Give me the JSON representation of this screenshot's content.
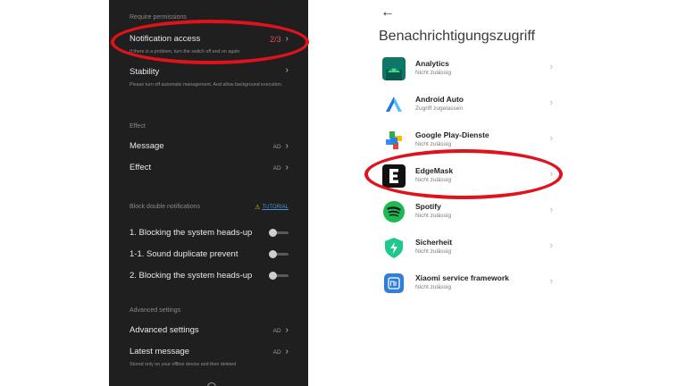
{
  "left_panel": {
    "section_require": "Require permissions",
    "notification_access": {
      "label": "Notification access",
      "value": "2/3",
      "hint": "If there is a problem, turn the switch off and on again"
    },
    "stability": {
      "label": "Stability",
      "hint": "Please turn off automatic management. And allow background execution."
    },
    "section_effect": "Effect",
    "message": {
      "label": "Message",
      "value": "AD"
    },
    "effect": {
      "label": "Effect",
      "value": "AD"
    },
    "section_block": "Block double notifications",
    "tutorial_label": "TUTORIAL",
    "toggles": [
      {
        "label": "1. Blocking the system heads-up",
        "on": false
      },
      {
        "label": "1-1. Sound duplicate prevent",
        "on": false
      },
      {
        "label": "2. Blocking the system heads-up",
        "on": false
      }
    ],
    "section_advanced": "Advanced settings",
    "advanced": {
      "label": "Advanced settings",
      "value": "AD"
    },
    "latest": {
      "label": "Latest message",
      "value": "AD",
      "hint": "Stored only on your offline device and then deleted"
    }
  },
  "right_panel": {
    "title": "Benachrichtigungszugriff",
    "apps": [
      {
        "name": "Analytics",
        "status": "Nicht zulässig",
        "icon": "android-icon"
      },
      {
        "name": "Android Auto",
        "status": "Zugriff zugelassen",
        "icon": "android-auto-icon"
      },
      {
        "name": "Google Play-Dienste",
        "status": "Nicht zulässig",
        "icon": "google-play-services-icon"
      },
      {
        "name": "EdgeMask",
        "status": "Nicht zulässig",
        "icon": "edgemask-icon"
      },
      {
        "name": "Spotify",
        "status": "Nicht zulässig",
        "icon": "spotify-icon"
      },
      {
        "name": "Sicherheit",
        "status": "Nicht zulässig",
        "icon": "security-shield-icon"
      },
      {
        "name": "Xiaomi service framework",
        "status": "Nicht zulässig",
        "icon": "xiaomi-service-icon"
      }
    ]
  },
  "colors": {
    "highlight": "#e0121b",
    "accent_counter": "#e0514d",
    "dark_bg": "#1f1f1f",
    "tutorial": "#4a90d9"
  }
}
